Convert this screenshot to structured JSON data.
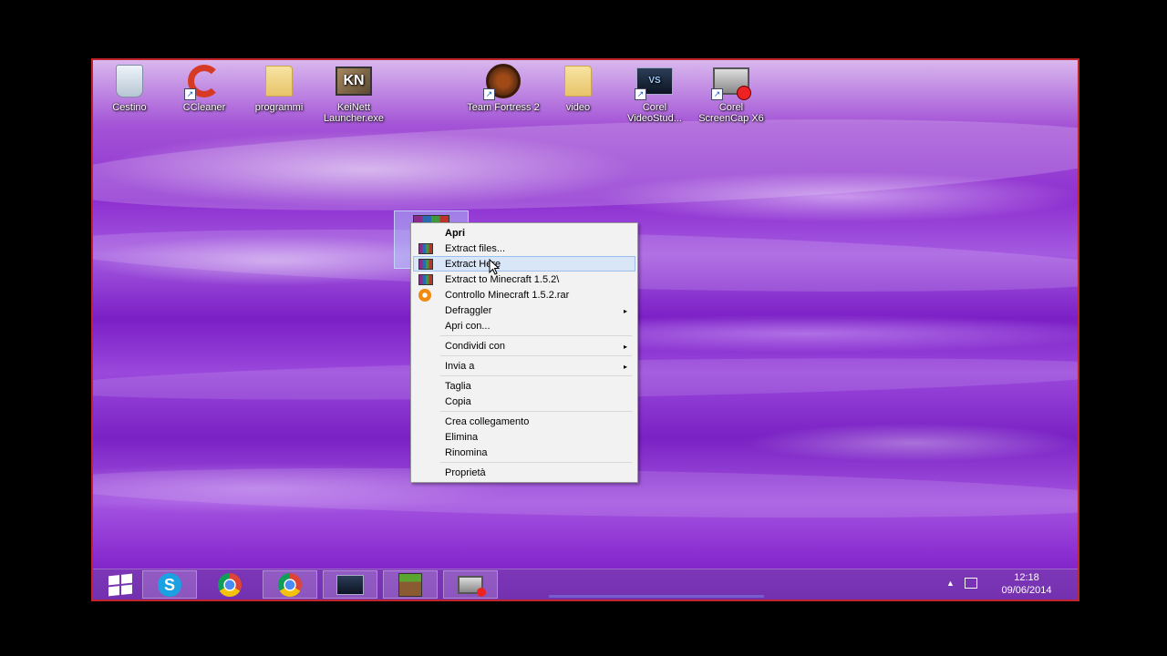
{
  "desktop": {
    "icons": [
      {
        "label": "Cestino",
        "icon": "recycle-bin-icon"
      },
      {
        "label": "CCleaner",
        "icon": "ccleaner-icon"
      },
      {
        "label": "programmi",
        "icon": "folder-icon"
      },
      {
        "label": "KeiNett Launcher.exe",
        "icon": "keinett-launcher-icon"
      },
      {
        "label": "Team Fortress 2",
        "icon": "team-fortress-icon"
      },
      {
        "label": "video",
        "icon": "folder-icon"
      },
      {
        "label": "Corel VideoStud...",
        "icon": "corel-videostudio-icon"
      },
      {
        "label": "Corel ScreenCap X6",
        "icon": "corel-screencap-icon"
      }
    ],
    "selected_file_icon": "winrar-archive-icon"
  },
  "context_menu": {
    "items": [
      {
        "label": "Apri",
        "bold": true
      },
      {
        "label": "Extract files...",
        "icon": "winrar-icon"
      },
      {
        "label": "Extract Here",
        "icon": "winrar-icon",
        "highlighted": true
      },
      {
        "label": "Extract to Minecraft 1.5.2\\",
        "icon": "winrar-icon"
      },
      {
        "label": "Controllo Minecraft 1.5.2.rar",
        "icon": "defraggler-icon"
      },
      {
        "label": "Defraggler",
        "submenu": true
      },
      {
        "label": "Apri con..."
      },
      {
        "label": "Condividi con",
        "submenu": true
      },
      {
        "label": "Invia a",
        "submenu": true
      },
      {
        "label": "Taglia"
      },
      {
        "label": "Copia"
      },
      {
        "label": "Crea collegamento"
      },
      {
        "label": "Elimina"
      },
      {
        "label": "Rinomina"
      },
      {
        "label": "Proprietà"
      }
    ],
    "submenu_arrow": "▸"
  },
  "taskbar": {
    "buttons": [
      "start-button",
      "skype-button",
      "chrome-button",
      "chrome-button-active",
      "corel-videostudio-button",
      "minecraft-button",
      "corel-screencap-button"
    ],
    "tray": {
      "show_hidden_arrow": "▲",
      "time": "12:18",
      "date": "09/06/2014"
    }
  },
  "colors": {
    "menu_highlight": "#d8e6f8",
    "frame_border": "#c0242c",
    "wallpaper_accent": "#8d2fd0"
  }
}
